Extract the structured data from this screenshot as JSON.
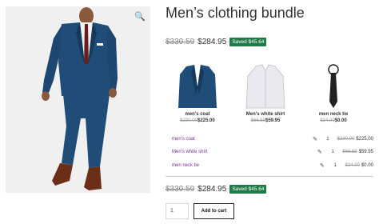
{
  "product": {
    "title": "Men’s clothing bundle",
    "price_old": "$330.59",
    "price_new": "$284.95",
    "saved_badge": "Saved $45.64"
  },
  "bundle_items": [
    {
      "name": "men's coat",
      "price_old": "$230.00",
      "price_new": "$225.00"
    },
    {
      "name": "Men's white shirt",
      "price_old": "$66.59",
      "price_new": "$59.95"
    },
    {
      "name": "men neck tie",
      "price_old": "$34.00",
      "price_new": "$0.00"
    }
  ],
  "rows": [
    {
      "name": "men's coat",
      "qty": "1",
      "price_old": "$230.00",
      "price_new": "$225.00"
    },
    {
      "name": "Men's white shirt",
      "qty": "1",
      "price_old": "$66.59",
      "price_new": "$59.95"
    },
    {
      "name": "men neck tie",
      "qty": "1",
      "price_old": "$34.00",
      "price_new": "$0.00"
    }
  ],
  "summary": {
    "price_old": "$330.59",
    "price_new": "$284.95",
    "saved_badge": "Saved $45.64"
  },
  "cart": {
    "quantity": "1",
    "button_label": "Add to cart"
  },
  "icons": {
    "zoom": "magnifier-icon",
    "edit": "edit-icon"
  },
  "colors": {
    "saved_badge": "#1f7a46",
    "link": "#7b2d9b"
  }
}
